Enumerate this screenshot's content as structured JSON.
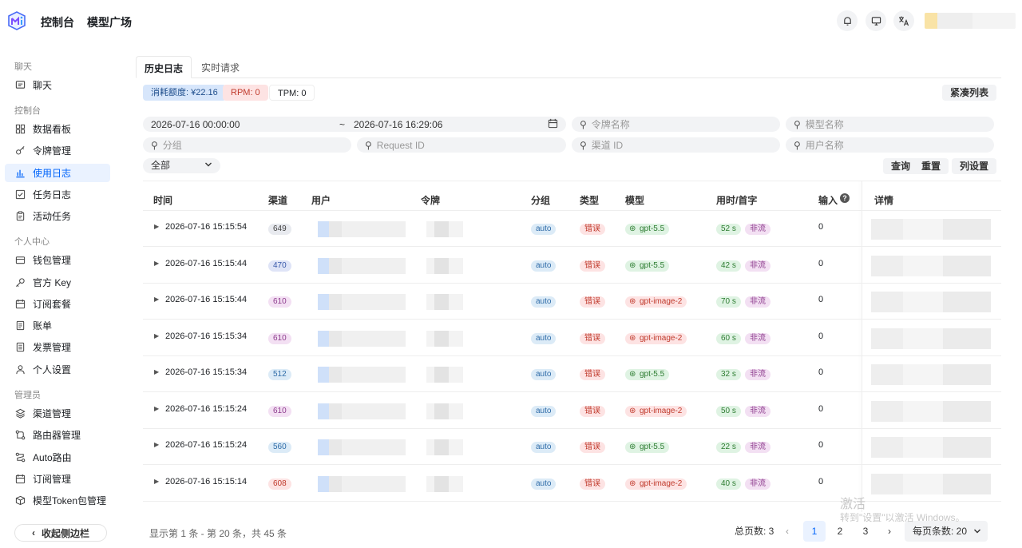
{
  "header": {
    "nav": [
      "控制台",
      "模型广场"
    ]
  },
  "sidebar": {
    "sections": [
      {
        "title": "聊天",
        "items": [
          {
            "label": "聊天",
            "icon": "chat-icon"
          }
        ]
      },
      {
        "title": "控制台",
        "items": [
          {
            "label": "数据看板",
            "icon": "dashboard-icon"
          },
          {
            "label": "令牌管理",
            "icon": "key-icon"
          },
          {
            "label": "使用日志",
            "icon": "bar-chart-icon",
            "active": true
          },
          {
            "label": "任务日志",
            "icon": "checklist-icon"
          },
          {
            "label": "活动任务",
            "icon": "clipboard-icon"
          }
        ]
      },
      {
        "title": "个人中心",
        "items": [
          {
            "label": "钱包管理",
            "icon": "wallet-icon"
          },
          {
            "label": "官方 Key",
            "icon": "key-icon"
          },
          {
            "label": "订阅套餐",
            "icon": "calendar-icon"
          },
          {
            "label": "账单",
            "icon": "document-icon"
          },
          {
            "label": "发票管理",
            "icon": "invoice-icon"
          },
          {
            "label": "个人设置",
            "icon": "user-icon"
          }
        ]
      },
      {
        "title": "管理员",
        "items": [
          {
            "label": "渠道管理",
            "icon": "layers-icon"
          },
          {
            "label": "路由器管理",
            "icon": "router-icon"
          },
          {
            "label": "Auto路由",
            "icon": "auto-route-icon"
          },
          {
            "label": "订阅管理",
            "icon": "calendar-icon"
          },
          {
            "label": "模型Token包管理",
            "icon": "package-icon"
          }
        ]
      }
    ],
    "collapse_label": "收起侧边栏"
  },
  "tabs": [
    "历史日志",
    "实时请求"
  ],
  "stats": {
    "quota": "消耗额度: ¥22.16",
    "rpm": "RPM: 0",
    "tpm": "TPM: 0"
  },
  "compact_label": "紧凑列表",
  "filters": {
    "date_start": "2026-07-16 00:00:00",
    "date_sep": "~",
    "date_end": "2026-07-16 16:29:06",
    "token_name": "令牌名称",
    "model_name": "模型名称",
    "group": "分组",
    "request_id": "Request ID",
    "channel_id": "渠道 ID",
    "user_name": "用户名称",
    "type_select": "全部"
  },
  "actions": {
    "query": "查询",
    "reset": "重置",
    "columns": "列设置"
  },
  "table": {
    "headers": [
      "时间",
      "渠道",
      "用户",
      "令牌",
      "分组",
      "类型",
      "模型",
      "用时/首字",
      "输入",
      "详情"
    ],
    "rows": [
      {
        "time": "2026-07-16 15:15:54",
        "channel": "649",
        "group": "auto",
        "type": "错误",
        "model": "gpt-5.5",
        "duration": "52 s",
        "stream": "非流",
        "input": "0"
      },
      {
        "time": "2026-07-16 15:15:44",
        "channel": "470",
        "group": "auto",
        "type": "错误",
        "model": "gpt-5.5",
        "duration": "42 s",
        "stream": "非流",
        "input": "0"
      },
      {
        "time": "2026-07-16 15:15:44",
        "channel": "610",
        "group": "auto",
        "type": "错误",
        "model": "gpt-image-2",
        "duration": "70 s",
        "stream": "非流",
        "input": "0"
      },
      {
        "time": "2026-07-16 15:15:34",
        "channel": "610",
        "group": "auto",
        "type": "错误",
        "model": "gpt-image-2",
        "duration": "60 s",
        "stream": "非流",
        "input": "0"
      },
      {
        "time": "2026-07-16 15:15:34",
        "channel": "512",
        "group": "auto",
        "type": "错误",
        "model": "gpt-5.5",
        "duration": "32 s",
        "stream": "非流",
        "input": "0"
      },
      {
        "time": "2026-07-16 15:15:24",
        "channel": "610",
        "group": "auto",
        "type": "错误",
        "model": "gpt-image-2",
        "duration": "50 s",
        "stream": "非流",
        "input": "0"
      },
      {
        "time": "2026-07-16 15:15:24",
        "channel": "560",
        "group": "auto",
        "type": "错误",
        "model": "gpt-5.5",
        "duration": "22 s",
        "stream": "非流",
        "input": "0"
      },
      {
        "time": "2026-07-16 15:15:14",
        "channel": "608",
        "group": "auto",
        "type": "错误",
        "model": "gpt-image-2",
        "duration": "40 s",
        "stream": "非流",
        "input": "0"
      }
    ]
  },
  "footer": {
    "info": "显示第 1 条 - 第 20 条，共 45 条",
    "total_pages": "总页数: 3",
    "pages": [
      "1",
      "2",
      "3"
    ],
    "page_size": "每页条数: 20"
  },
  "watermark": {
    "line1": "激活",
    "line2": "转到\"设置\"以激活 Windows。"
  }
}
